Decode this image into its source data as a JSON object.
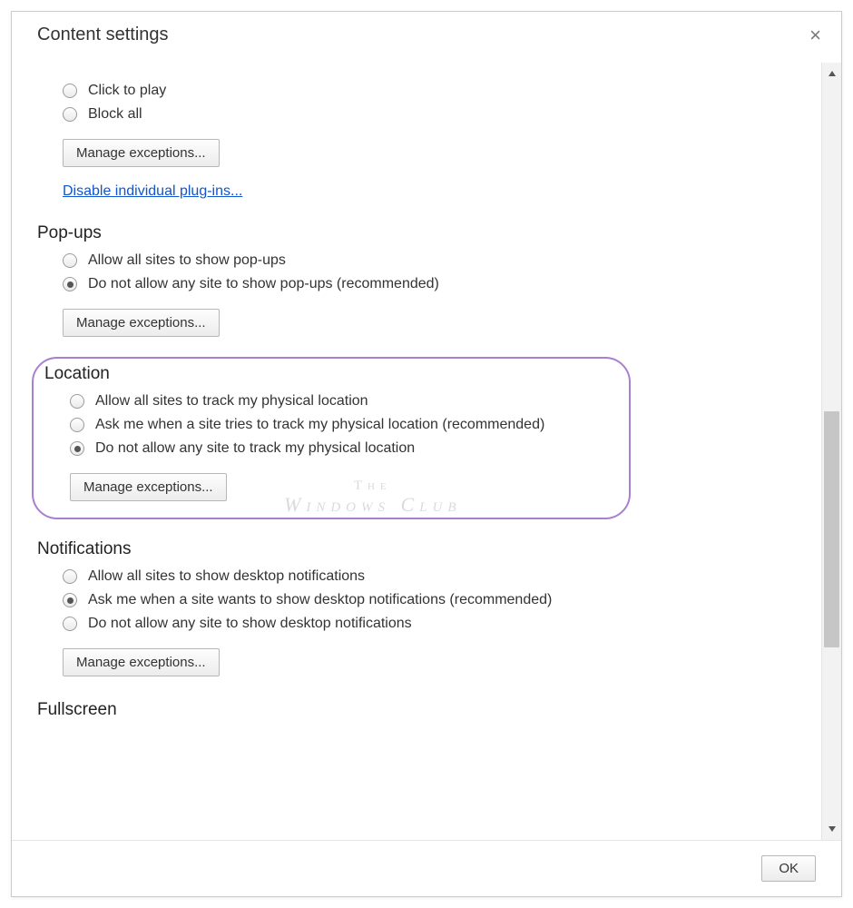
{
  "dialog": {
    "title": "Content settings",
    "close_label": "×",
    "ok_label": "OK"
  },
  "plugins": {
    "options": [
      {
        "label": "Click to play",
        "checked": false
      },
      {
        "label": "Block all",
        "checked": false
      }
    ],
    "manage": "Manage exceptions...",
    "link": "Disable individual plug-ins..."
  },
  "popups": {
    "title": "Pop-ups",
    "options": [
      {
        "label": "Allow all sites to show pop-ups",
        "checked": false
      },
      {
        "label": "Do not allow any site to show pop-ups (recommended)",
        "checked": true
      }
    ],
    "manage": "Manage exceptions..."
  },
  "location": {
    "title": "Location",
    "options": [
      {
        "label": "Allow all sites to track my physical location",
        "checked": false
      },
      {
        "label": "Ask me when a site tries to track my physical location (recommended)",
        "checked": false
      },
      {
        "label": "Do not allow any site to track my physical location",
        "checked": true
      }
    ],
    "manage": "Manage exceptions..."
  },
  "notifications": {
    "title": "Notifications",
    "options": [
      {
        "label": "Allow all sites to show desktop notifications",
        "checked": false
      },
      {
        "label": "Ask me when a site wants to show desktop notifications (recommended)",
        "checked": true
      },
      {
        "label": "Do not allow any site to show desktop notifications",
        "checked": false
      }
    ],
    "manage": "Manage exceptions..."
  },
  "fullscreen": {
    "title": "Fullscreen"
  },
  "watermark": {
    "line1": "The",
    "line2": "Windows Club"
  }
}
